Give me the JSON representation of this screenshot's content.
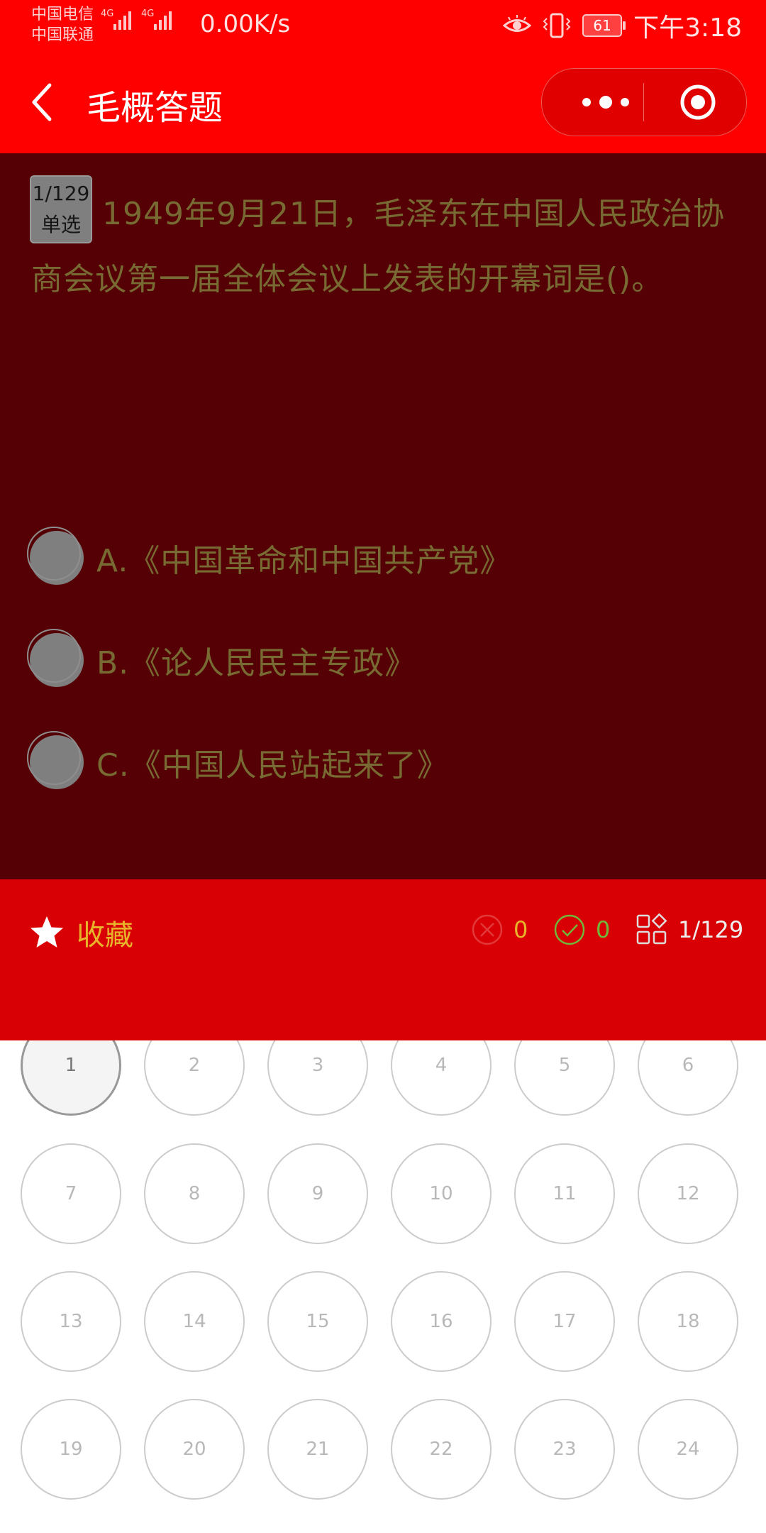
{
  "status_bar": {
    "carrier_1": "中国电信",
    "carrier_2": "中国联通",
    "network_1": "4G",
    "network_2": "4G",
    "speed": "0.00K/s",
    "battery": "61",
    "time": "下午3:18",
    "icons": [
      "eye-icon",
      "vibrate-icon",
      "battery-icon"
    ]
  },
  "nav": {
    "title": "毛概答题",
    "back_icon": "chevron-left-icon",
    "more_icon": "more-dots-icon",
    "close_icon": "target-circle-icon"
  },
  "question": {
    "progress": "1/129",
    "type": "单选",
    "text": "1949年9月21日，毛泽东在中国人民政治协商会议第一届全体会议上发表的开幕词是()。",
    "options": [
      {
        "label": "A.《中国革命和中国共产党》"
      },
      {
        "label": "B.《论人民民主专政》"
      },
      {
        "label": "C.《中国人民站起来了》"
      }
    ]
  },
  "action_bar": {
    "favorite_label": "收藏",
    "wrong_count": "0",
    "correct_count": "0",
    "progress": "1/129"
  },
  "grid": {
    "current": "1",
    "numbers": [
      "1",
      "2",
      "3",
      "4",
      "5",
      "6",
      "7",
      "8",
      "9",
      "10",
      "11",
      "12",
      "13",
      "14",
      "15",
      "16",
      "17",
      "18",
      "19",
      "20",
      "21",
      "22",
      "23",
      "24"
    ]
  },
  "colors": {
    "header_red": "#fe0000",
    "question_bg": "#550005",
    "action_bar_red": "#d80005",
    "text_olive": "#776a32",
    "favorite_gold": "#e8b52a",
    "wrong_red": "#e23a3a",
    "correct_green": "#6fb83a"
  }
}
